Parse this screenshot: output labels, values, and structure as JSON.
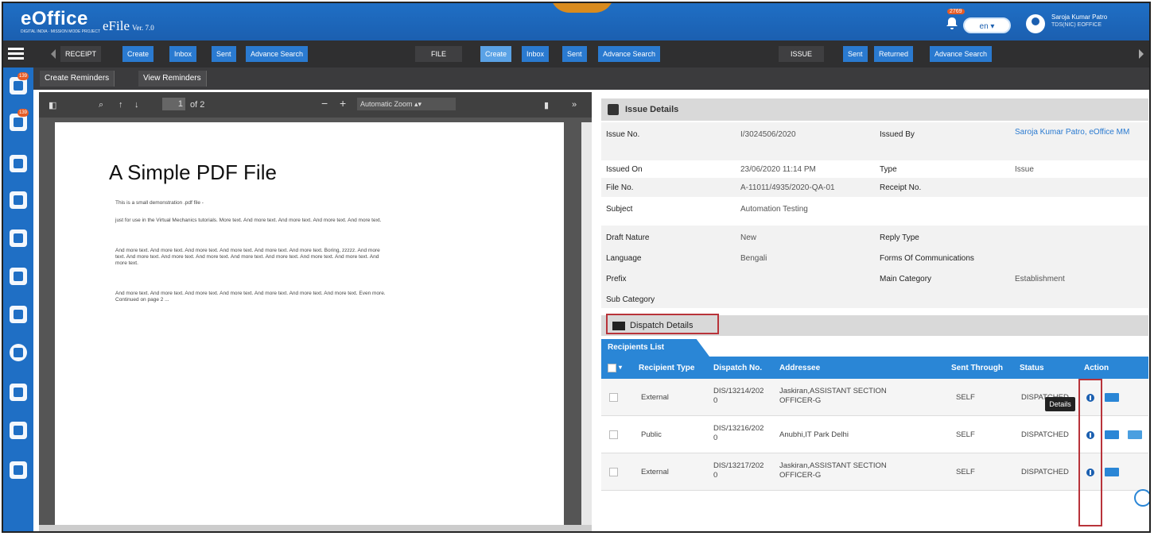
{
  "header": {
    "brand": "eOffice",
    "brand_tag": "DIGITAL INDIA · MISSION MODE PROJECT",
    "app_name": "eFile",
    "version": "Ver. 7.0",
    "notif_count": "2769",
    "language": "en",
    "user_name": "Saroja Kumar Patro",
    "user_office": "TDS(NIC) EOFFICE"
  },
  "menubar": {
    "receipt": {
      "section": "RECEIPT",
      "items": [
        "Create",
        "Inbox",
        "Sent",
        "Advance Search"
      ]
    },
    "file": {
      "section": "FILE",
      "items": [
        "Create",
        "Inbox",
        "Sent",
        "Advance Search"
      ]
    },
    "issue": {
      "section": "ISSUE",
      "items": [
        "Sent",
        "Returned",
        "Advance Search"
      ]
    }
  },
  "subbar": {
    "create_reminders": "Create Reminders",
    "view_reminders": "View Reminders"
  },
  "sidebar": {
    "badge1": "139",
    "badge2": "139"
  },
  "pdf_toolbar": {
    "page_current": "1",
    "page_total": "of 2",
    "zoom": "Automatic Zoom"
  },
  "pdf": {
    "title": "A Simple PDF File",
    "p1": "This is a small demonstration .pdf file -",
    "p2": "just for use in the Virtual Mechanics tutorials. More text. And more text. And more text. And more text. And more text.",
    "p3": "And more text. And more text. And more text. And more text. And more text. And more text. Boring, zzzzz. And more text. And more text. And more text. And more text. And more text. And more text. And more text. And more text. And more text.",
    "p4": "And more text. And more text. And more text. And more text. And more text. And more text. And more text. Even more. Continued on page 2 ..."
  },
  "issue_details": {
    "title": "Issue Details",
    "issue_no_label": "Issue No.",
    "issue_no": "I/3024506/2020",
    "issued_by_label": "Issued By",
    "issued_by": "Saroja Kumar Patro, eOffice MM",
    "issued_on_label": "Issued On",
    "issued_on": "23/06/2020 11:14 PM",
    "type_label": "Type",
    "type": "Issue",
    "file_no_label": "File No.",
    "file_no": "A-11011/4935/2020-QA-01",
    "receipt_no_label": "Receipt No.",
    "subject_label": "Subject",
    "subject": "Automation Testing",
    "draft_nature_label": "Draft Nature",
    "draft_nature": "New",
    "reply_type_label": "Reply Type",
    "language_label": "Language",
    "language": "Bengali",
    "forms_label": "Forms Of Communications",
    "prefix_label": "Prefix",
    "main_category_label": "Main Category",
    "main_category": "Establishment",
    "sub_category_label": "Sub Category"
  },
  "dispatch": {
    "title": "Dispatch Details",
    "recipients_list": "Recipients List",
    "columns": [
      "Recipient Type",
      "Dispatch No.",
      "Addressee",
      "Sent Through",
      "Status",
      "Action"
    ],
    "rows": [
      {
        "type": "External",
        "dispatch_no": "DIS/13214/2020",
        "addressee": "Jaskiran,ASSISTANT SECTION OFFICER-G",
        "sent_through": "SELF",
        "status": "DISPATCHED"
      },
      {
        "type": "Public",
        "dispatch_no": "DIS/13216/2020",
        "addressee": "Anubhi,IT Park Delhi",
        "sent_through": "SELF",
        "status": "DISPATCHED"
      },
      {
        "type": "External",
        "dispatch_no": "DIS/13217/2020",
        "addressee": "Jaskiran,ASSISTANT SECTION OFFICER-G",
        "sent_through": "SELF",
        "status": "DISPATCHED"
      }
    ],
    "tooltip": "Details"
  }
}
